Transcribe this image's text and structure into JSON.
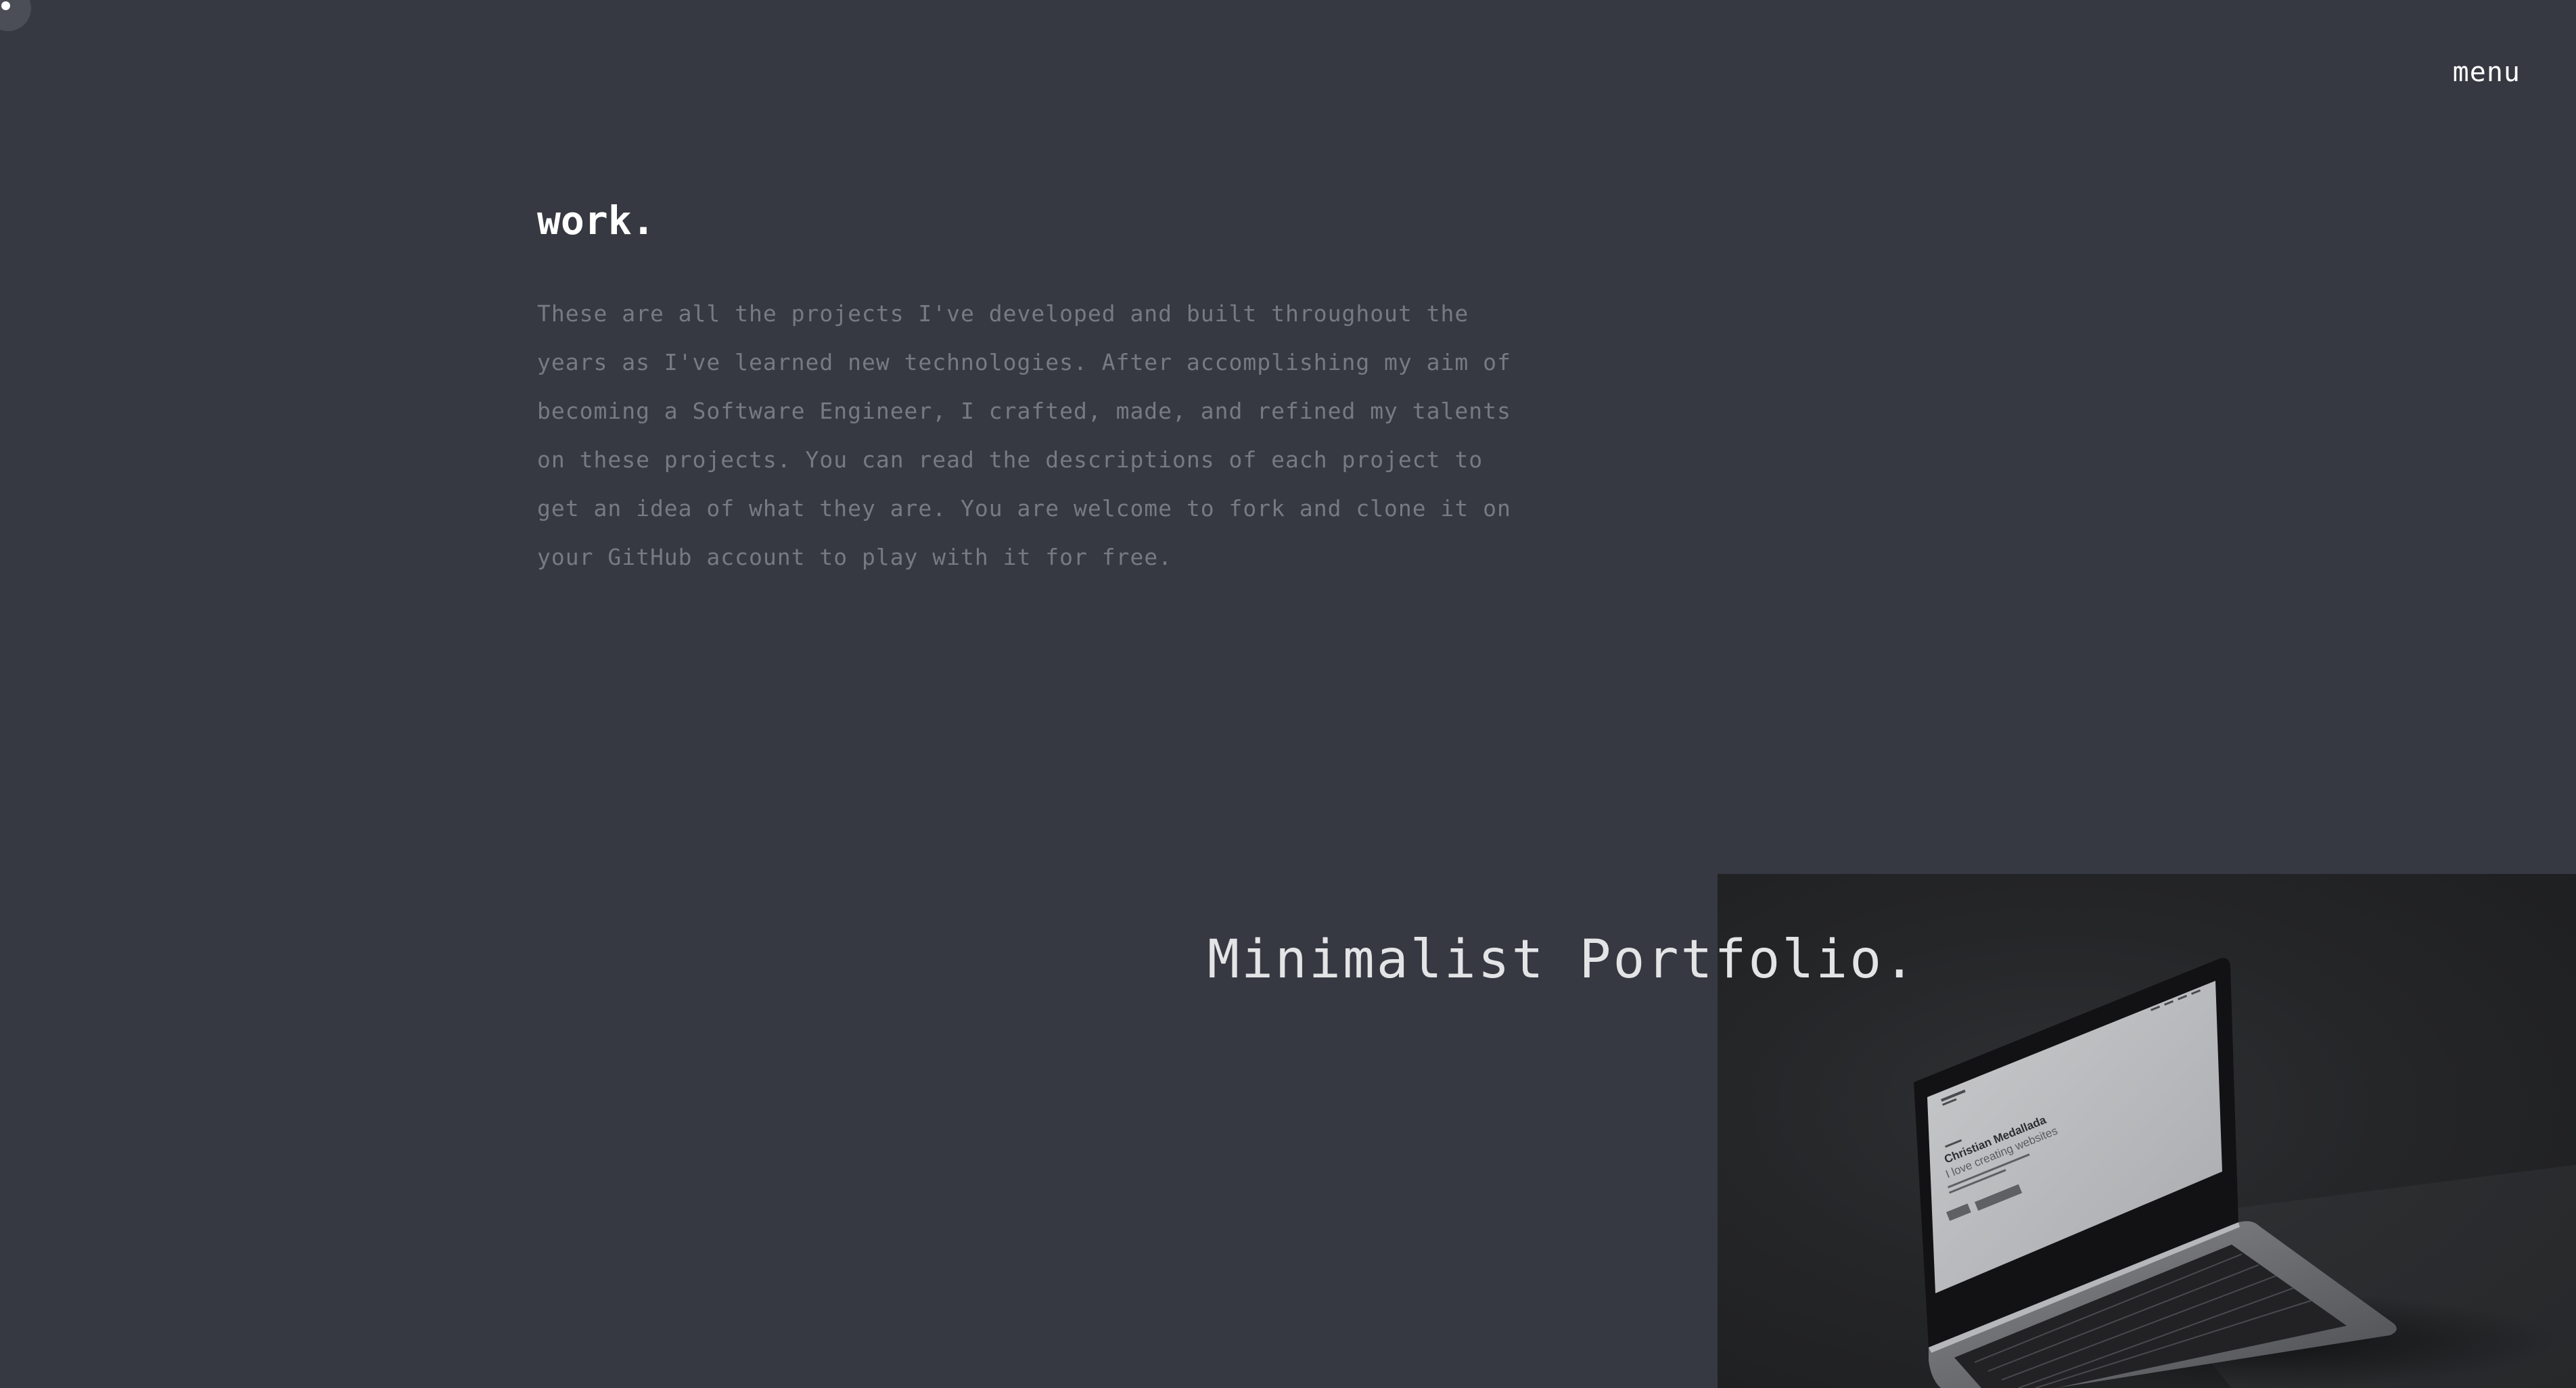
{
  "nav": {
    "menu_label": "menu"
  },
  "page": {
    "title": "work.",
    "description": "These are all the projects I've developed and built throughout the years as I've learned new technologies. After accomplishing my aim of becoming a Software Engineer, I crafted, made, and refined my talents on these projects. You can read the descriptions of each project to get an idea of what they are. You are welcome to fork and clone it on your GitHub account to play with it for free."
  },
  "projects": [
    {
      "name": "Minimalist Portfolio.",
      "preview": {
        "heading": "Christian Medallada",
        "subheading": "I love creating websites"
      }
    }
  ],
  "colors": {
    "background": "#363941",
    "heading": "#ffffff",
    "description": "#777a82",
    "project_title": "#e3e4e6"
  }
}
